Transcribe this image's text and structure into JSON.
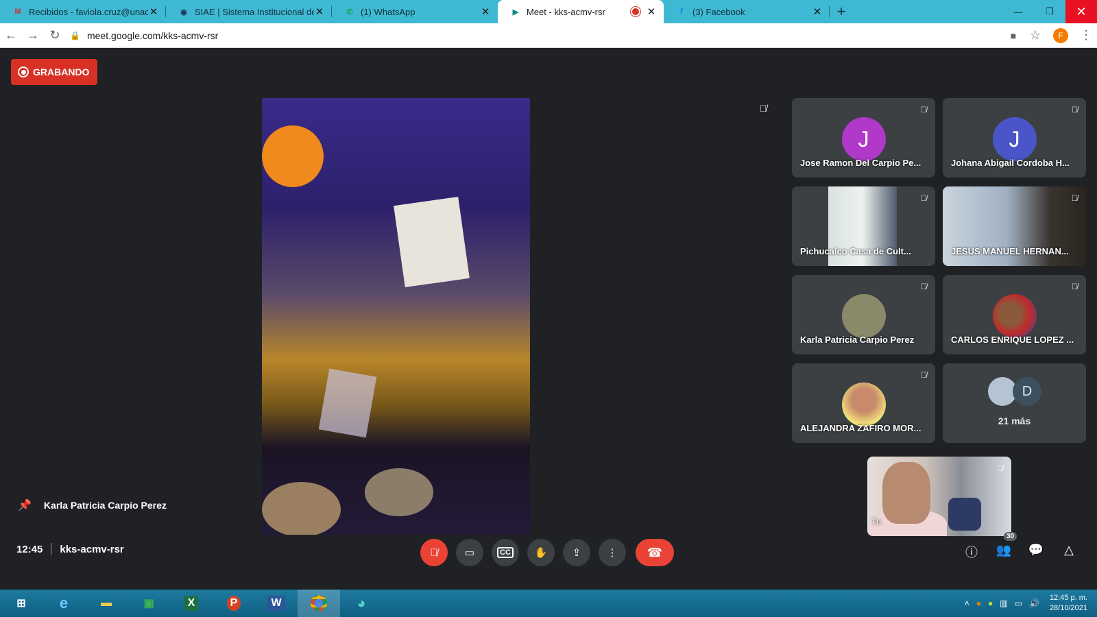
{
  "tabs": [
    {
      "title": "Recibidos - faviola.cruz@unach.m",
      "icon": "gmail-icon",
      "icon_glyph": "M",
      "icon_color": "#d93025"
    },
    {
      "title": "SIAE | Sistema Institucional de Ac",
      "icon": "siae-icon",
      "icon_glyph": "◉",
      "icon_color": "#1b3a5a"
    },
    {
      "title": "(1) WhatsApp",
      "icon": "whatsapp-icon",
      "icon_glyph": "✆",
      "icon_color": "#25d366"
    },
    {
      "title": "Meet - kks-acmv-rsr",
      "icon": "meet-icon",
      "icon_glyph": "▶",
      "icon_color": "#00897b"
    },
    {
      "title": "(3) Facebook",
      "icon": "facebook-icon",
      "icon_glyph": "f",
      "icon_color": "#1877f2"
    }
  ],
  "address": {
    "url": "meet.google.com/kks-acmv-rsr",
    "profile_initial": "F"
  },
  "meet": {
    "recording_label": "GRABANDO",
    "pinned_name": "Karla Patricia Carpio Perez",
    "self_label": "Tú",
    "more_count": "21 más",
    "more_initial": "D",
    "people_count": "30",
    "time": "12:45",
    "meeting_code": "kks-acmv-rsr"
  },
  "participants": [
    {
      "name": "Jose Ramon Del Carpio Pe...",
      "type": "avatar",
      "initial": "J",
      "color": "#b039c9"
    },
    {
      "name": "Johana Abigail Cordoba H...",
      "type": "avatar",
      "initial": "J",
      "color": "#4a55c8"
    },
    {
      "name": "Pichucalco Casa de Cult...",
      "type": "video"
    },
    {
      "name": "JESUS MANUEL HERNAN...",
      "type": "video"
    },
    {
      "name": "Karla Patricia Carpio Perez",
      "type": "photo"
    },
    {
      "name": "CARLOS ENRIQUE LOPEZ ...",
      "type": "photo"
    },
    {
      "name": "ALEJANDRA ZAFIRO MOR...",
      "type": "photo"
    }
  ],
  "taskbar": {
    "time": "12:45 p. m.",
    "date": "28/10/2021"
  }
}
